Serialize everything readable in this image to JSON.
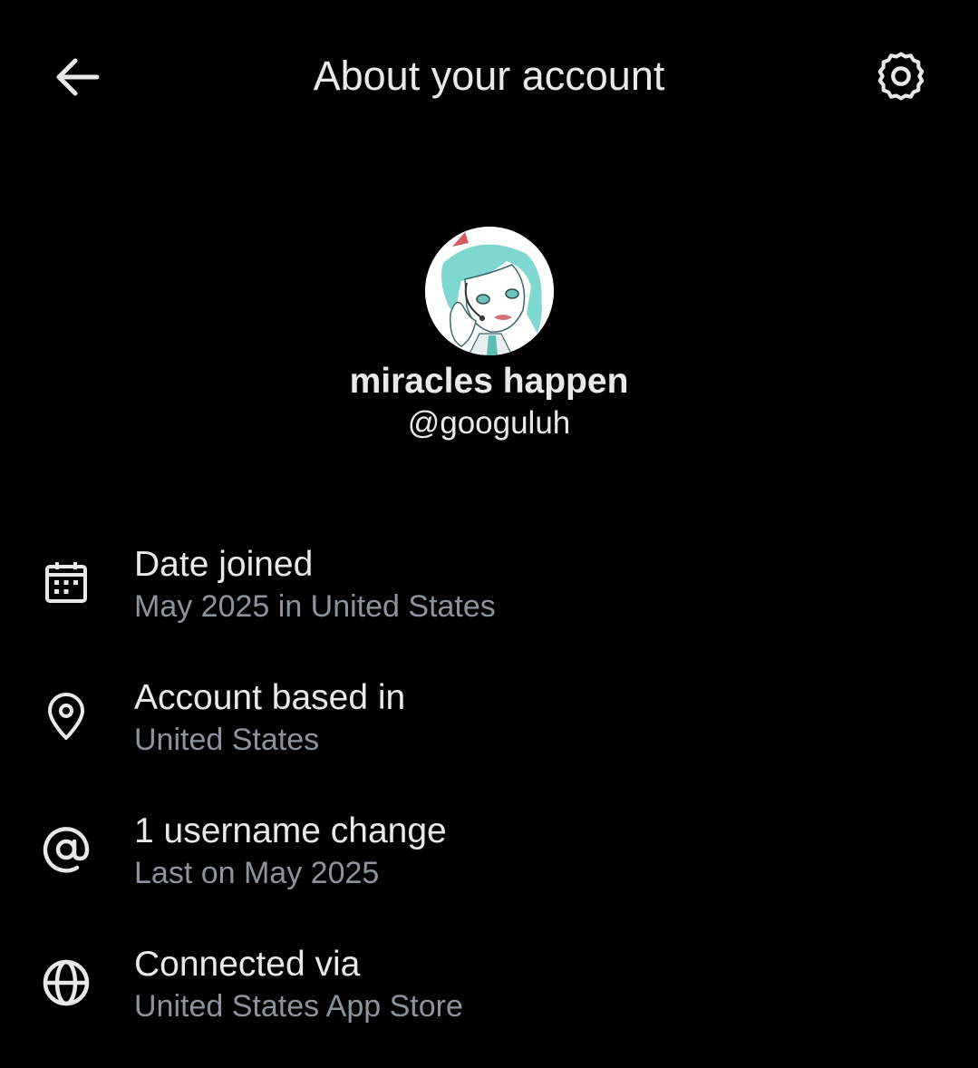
{
  "header": {
    "title": "About your account",
    "back_icon": "arrow-left-icon",
    "settings_icon": "gear-icon"
  },
  "profile": {
    "display_name": "miracles happen",
    "handle": "@googuluh",
    "avatar": "anime-character-avatar"
  },
  "info": [
    {
      "icon": "calendar-icon",
      "title": "Date joined",
      "subtitle": "May 2025 in United States"
    },
    {
      "icon": "location-pin-icon",
      "title": "Account based in",
      "subtitle": "United States"
    },
    {
      "icon": "at-sign-icon",
      "title": "1 username change",
      "subtitle": "Last on May 2025"
    },
    {
      "icon": "globe-icon",
      "title": "Connected via",
      "subtitle": "United States App Store"
    }
  ],
  "colors": {
    "background": "#000000",
    "primary_text": "#e7e9ea",
    "secondary_text": "#8b949c",
    "avatar_hair": "#7fd8cf"
  }
}
